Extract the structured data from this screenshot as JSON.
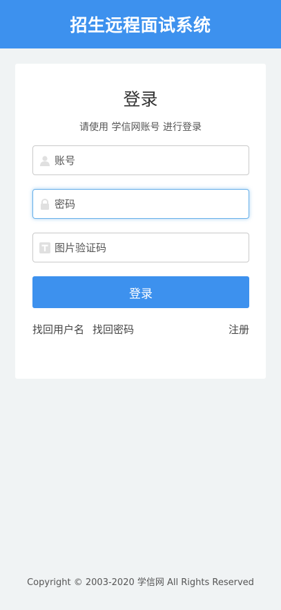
{
  "header": {
    "title": "招生远程面试系统"
  },
  "login": {
    "title": "登录",
    "subtitle": "请使用 学信网账号 进行登录",
    "username": {
      "placeholder": "账号",
      "value": "",
      "icon": "user-icon"
    },
    "password": {
      "placeholder": "密码",
      "value": "",
      "icon": "lock-icon"
    },
    "captcha": {
      "placeholder": "图片验证码",
      "value": "",
      "icon": "captcha-icon"
    },
    "submit_label": "登录",
    "links": {
      "find_username": "找回用户名",
      "find_password": "找回密码",
      "register": "注册"
    }
  },
  "footer": {
    "copyright": "Copyright © 2003-2020 学信网 All Rights Reserved"
  },
  "colors": {
    "brand": "#3d91ee",
    "background": "#f0f3f4",
    "card": "#ffffff",
    "focus": "#66afe9"
  }
}
